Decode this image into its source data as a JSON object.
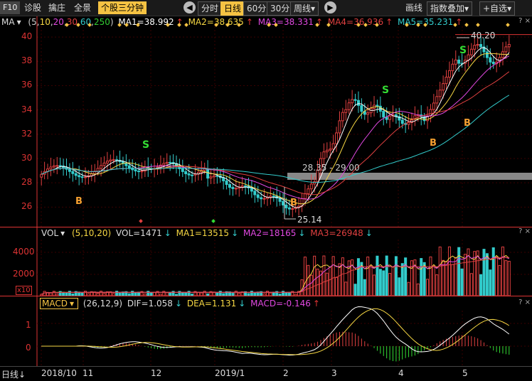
{
  "toolbar": {
    "f10": "F10",
    "diagnose": "诊股",
    "capture": "擒庄",
    "fullscreen": "全景",
    "mode": "个股三分钟",
    "periods": [
      "分时",
      "日线",
      "60分",
      "30分"
    ],
    "week": "周线",
    "draw": "画线",
    "index_overlay": "指数叠加",
    "add_watch": "+自选",
    "dropdown_glyph": "▾",
    "prev_glyph": "◀",
    "next_glyph": "▶"
  },
  "main_indicator": {
    "name": "MA",
    "params_prefix": "(5,",
    "params": [
      "10",
      "20",
      "30",
      "60",
      "250"
    ],
    "params_suffix": ")",
    "ma": [
      {
        "label": "MA1=38.992",
        "color": "#ffffff"
      },
      {
        "label": "MA2=38.635",
        "color": "#f6d743"
      },
      {
        "label": "MA3=38.331",
        "color": "#e048e0"
      },
      {
        "label": "MA4=36.936",
        "color": "#e04040"
      },
      {
        "label": "MA5=35.231",
        "color": "#33cccc"
      }
    ],
    "y_ticks": [
      "40",
      "38",
      "36",
      "34",
      "32",
      "30",
      "28",
      "26"
    ],
    "annotations": {
      "high": "40.20",
      "low": "25.14",
      "range": "28.35 - 29.00",
      "buy": "B",
      "sell": "S"
    }
  },
  "volume": {
    "name": "VOL",
    "params": "(5,10,20)",
    "vol": "VOL=1471",
    "ma": [
      {
        "label": "MA1=13515",
        "color": "#f6d743"
      },
      {
        "label": "MA2=18165",
        "color": "#e048e0"
      },
      {
        "label": "MA3=26948",
        "color": "#e04040"
      }
    ],
    "y_ticks": [
      "4000",
      "2000"
    ],
    "unit": "x10"
  },
  "macd": {
    "name": "MACD",
    "params": "(26,12,9)",
    "dif": "DIF=1.058",
    "dea": "DEA=1.131",
    "macd": "MACD=-0.146",
    "y_ticks": [
      "1",
      "0"
    ]
  },
  "xaxis": {
    "period_label": "日线",
    "labels": [
      "2018/10",
      "11",
      "12",
      "2019/1",
      "2",
      "3",
      "4",
      "5"
    ]
  },
  "corner_icons": {
    "help": "?",
    "close": "×"
  },
  "colors": {
    "up": "#e04040",
    "down": "#33cccc",
    "accent": "#f6c343",
    "ma1": "#ffffff",
    "ma2": "#f6d743",
    "ma3": "#e048e0",
    "ma4": "#e04040",
    "ma5": "#33cccc"
  }
}
